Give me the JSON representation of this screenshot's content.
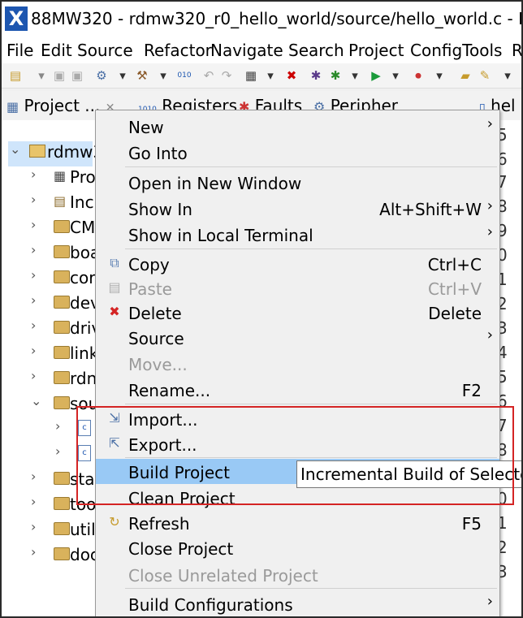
{
  "window": {
    "title": "88MW320 - rdmw320_r0_hello_world/source/hello_world.c - N"
  },
  "menubar": {
    "items": [
      "File",
      "Edit",
      "Source",
      "Refactor",
      "Navigate",
      "Search",
      "Project",
      "ConfigTools",
      "R"
    ]
  },
  "tabs": {
    "project": "Project ...",
    "registers": "Registers",
    "faults": "Faults",
    "peripherals": "Peripher",
    "editor": "hel"
  },
  "tree": {
    "root": "rdmw3",
    "items": [
      "Pro",
      "Inc",
      "CM",
      "boa",
      "cor",
      "dev",
      "driv",
      "link",
      "rdn",
      "sou",
      "",
      "",
      "sta",
      "too",
      "util",
      "doc"
    ]
  },
  "gutter": [
    "5",
    "6",
    "7",
    "8",
    "9",
    "0",
    "1",
    "2",
    "3",
    "4",
    "5",
    "6",
    "7",
    "8",
    "9",
    "0",
    "1",
    "2",
    "3"
  ],
  "context_menu": {
    "items": [
      {
        "label": "New",
        "accel": "",
        "submenu": true
      },
      {
        "label": "Go Into",
        "accel": ""
      },
      {
        "label": "Open in New Window",
        "accel": ""
      },
      {
        "label": "Show In",
        "accel": "Alt+Shift+W",
        "submenu": true
      },
      {
        "label": "Show in Local Terminal",
        "accel": "",
        "submenu": true
      },
      {
        "label": "Copy",
        "accel": "Ctrl+C"
      },
      {
        "label": "Paste",
        "accel": "Ctrl+V",
        "disabled": true
      },
      {
        "label": "Delete",
        "accel": "Delete"
      },
      {
        "label": "Source",
        "accel": "",
        "submenu": true
      },
      {
        "label": "Move...",
        "accel": "",
        "disabled": true
      },
      {
        "label": "Rename...",
        "accel": "F2"
      },
      {
        "label": "Import...",
        "accel": ""
      },
      {
        "label": "Export...",
        "accel": ""
      },
      {
        "label": "Build Project",
        "accel": "",
        "selected": true
      },
      {
        "label": "Clean Project",
        "accel": ""
      },
      {
        "label": "Refresh",
        "accel": "F5"
      },
      {
        "label": "Close Project",
        "accel": ""
      },
      {
        "label": "Close Unrelated Project",
        "accel": "",
        "disabled": true
      },
      {
        "label": "Build Configurations",
        "accel": "",
        "submenu": true
      }
    ]
  },
  "tooltip": {
    "text": "Incremental Build of Selecte"
  },
  "colors": {
    "selection": "#99c9f5",
    "highlight_box": "#d42424",
    "app_icon": "#1d56b0"
  }
}
